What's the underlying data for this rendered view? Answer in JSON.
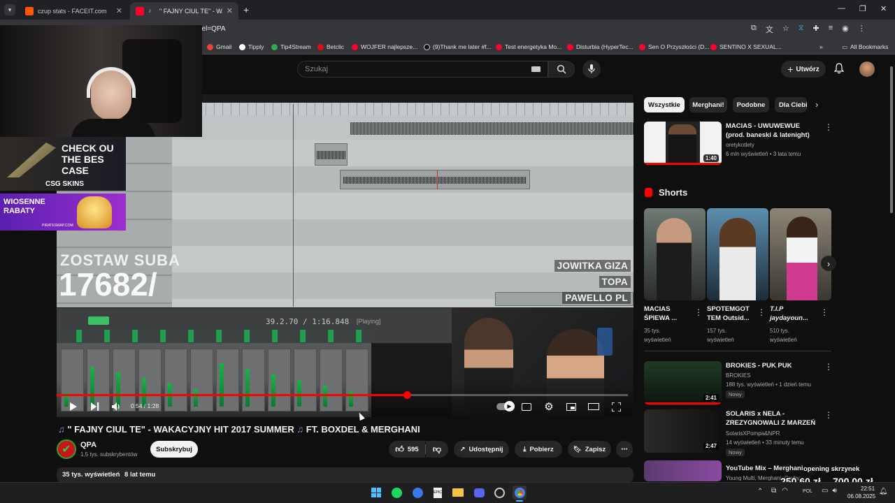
{
  "browser": {
    "tabs": [
      {
        "label": "czup stats - FACEIT.com",
        "active": false
      },
      {
        "label": "\" FAJNY CIUL TE\" - WAKACYJ",
        "active": true
      }
    ],
    "url": "nel=QPA",
    "bookmarks": [
      "Gmail",
      "Tipply",
      "Tip4Stream",
      "Betclic",
      "WOJFER najlepsze...",
      "(9)Thank me later #f...",
      "Test energetyka Mo...",
      "Disturbia (HyperTec...",
      "Sen O Przyszłości (D...",
      "SENTINO X SEXUAL..."
    ],
    "all_bookmarks": "All Bookmarks"
  },
  "youtube": {
    "search_placeholder": "Szukaj",
    "create_label": "Utwórz"
  },
  "overlay": {
    "ad1_text": "CHECK OU THE BES CASE",
    "ad1_brand": "CSG SKINS",
    "ad2_text": "WIOSENNE RABATY",
    "ad2_brand": "PIRATESWAP.COM",
    "stream_sub": "ZOSTAW SUBA",
    "stream_count": "17682/"
  },
  "video": {
    "daw_time": "39.2.70 / 1:16.848",
    "daw_state": "[Playing]",
    "names": [
      "JOWITKA GIZA",
      "TOPA",
      "PAWELLO PL"
    ],
    "time": "0:54 / 1:28",
    "progress": 0.6136,
    "title": "\" FAJNY CIUL TE\" - WAKACYJNY HIT 2017 SUMMER",
    "title_suffix": "FT. BOXDEL & MERGHANI"
  },
  "channel": {
    "name": "QPA",
    "subs": "1,5 tys. subskrybentów",
    "subscribe": "Subskrybuj"
  },
  "actions": {
    "likes": "595",
    "share": "Udostępnij",
    "download": "Pobierz",
    "save": "Zapisz"
  },
  "description": {
    "views": "35 tys. wyświetleń",
    "ago": "8 lat temu"
  },
  "chips": [
    "Wszystkie",
    "Merghani!",
    "Podobne",
    "Dla Ciebie"
  ],
  "related_top": {
    "title": "MACIAS - UWUWEWUE (prod. baneski & latenight)",
    "channel": "oretykotlety",
    "meta": "6 mln wyświetleń • 3 lata temu",
    "duration": "1:40"
  },
  "shorts": {
    "heading": "Shorts",
    "items": [
      {
        "title": "MACIAS ŚPIEWA ...",
        "views": "35 tys.",
        "views2": "wyświetleń"
      },
      {
        "title": "SPOTEMGOT TEM Outsid...",
        "views": "157 tys.",
        "views2": "wyświetleń"
      },
      {
        "title": "T.I.P jaydayoun...",
        "views": "510 tys.",
        "views2": "wyświetleń"
      }
    ]
  },
  "related": [
    {
      "title": "BROKIES - PUK PUK",
      "channel": "BROKIES",
      "meta": "188 tys. wyświetleń • 1 dzień temu",
      "badge": "Nowy",
      "duration": "2:41"
    },
    {
      "title": "SOLARIS x NELA - ZREZYGNOWALI Z MARZEŃ",
      "channel": "SolarisXPompa&NPR",
      "meta": "14 wyświetleń • 33 minuty temu",
      "badge": "Nowy",
      "duration": "2:47"
    },
    {
      "title": "YouTube Mix – Merghani",
      "channel": "Young Multi, Merghani, Gruby...",
      "meta": "",
      "badge": "",
      "duration": ""
    }
  ],
  "stream_overlay": {
    "opening_text": "opening skrzynek",
    "money_1": "250,60 zł",
    "money_2": "700,00 zł"
  },
  "taskbar": {
    "time": "22:51",
    "date": "06.08.2025",
    "lang": "POL"
  },
  "colors": {
    "accent": "#ff0000",
    "subscribe_bg": "#f1f1f1",
    "bg": "#0f0f0f"
  }
}
